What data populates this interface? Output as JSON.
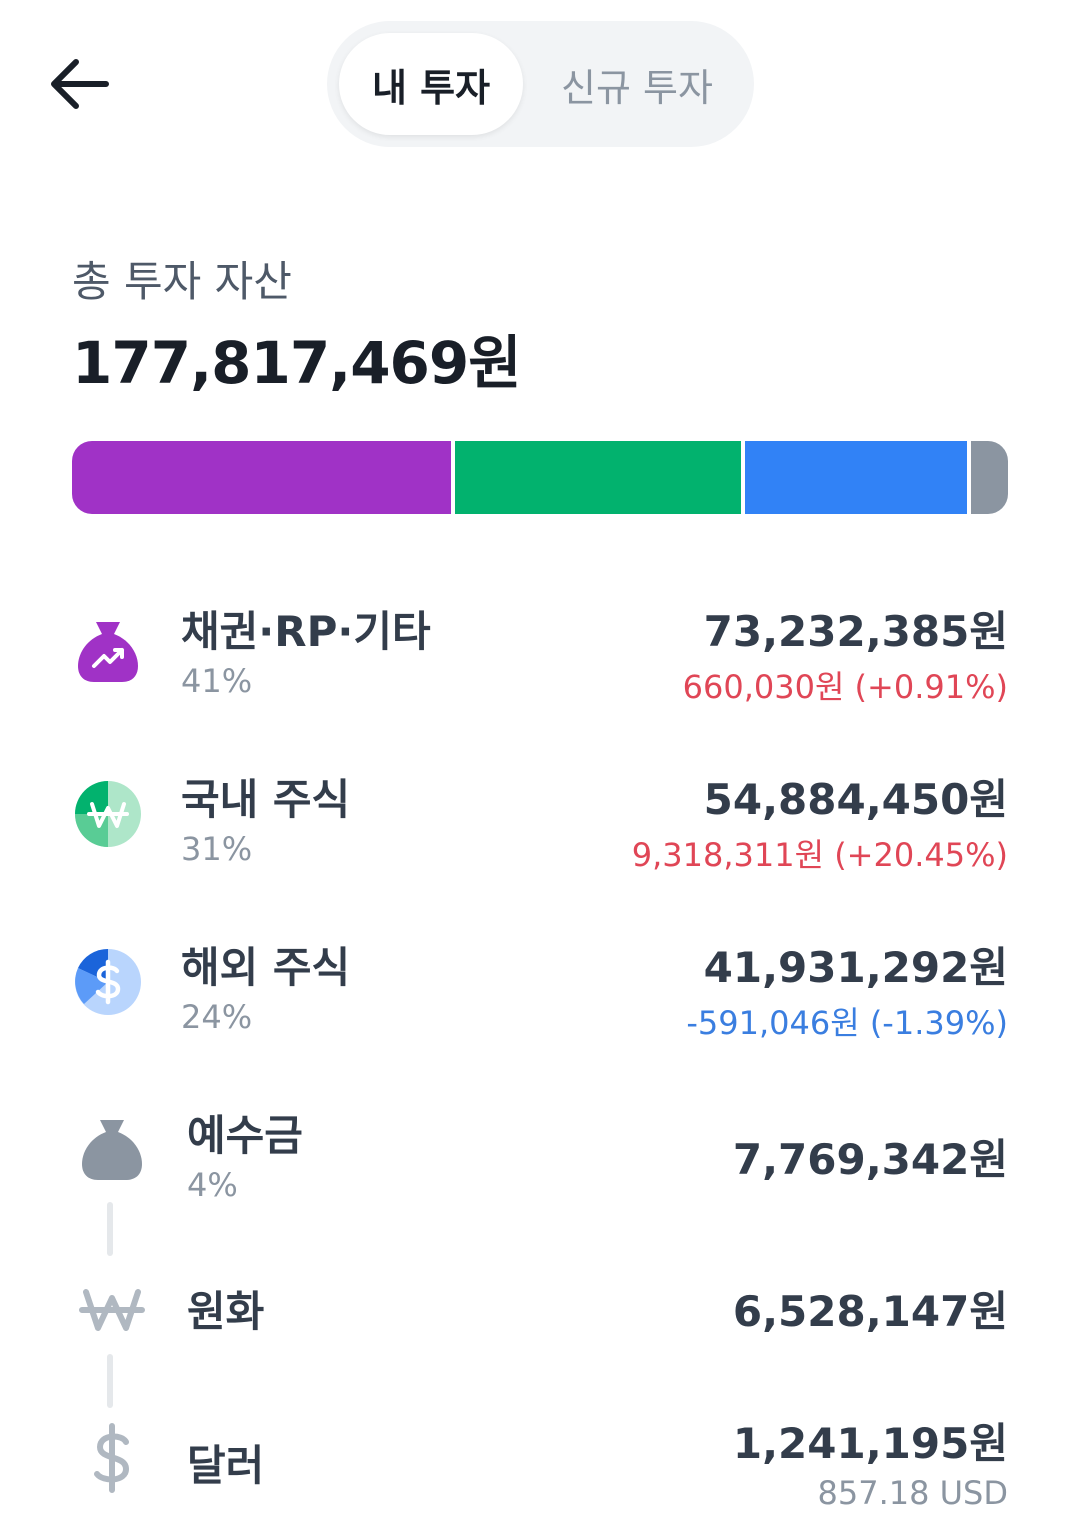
{
  "header": {
    "back_icon": "arrow-left-icon",
    "tabs": [
      {
        "label": "내 투자",
        "active": true
      },
      {
        "label": "신규 투자",
        "active": false
      }
    ]
  },
  "summary": {
    "label": "총 투자 자산",
    "total": "177,817,469원"
  },
  "allocation_bar": [
    {
      "name": "채권·RP·기타",
      "fraction": 0.41,
      "color": "#a032c6"
    },
    {
      "name": "국내 주식",
      "fraction": 0.31,
      "color": "#02b26e"
    },
    {
      "name": "해외 주식",
      "fraction": 0.24,
      "color": "#3182f6"
    },
    {
      "name": "예수금",
      "fraction": 0.04,
      "color": "#8b95a1"
    }
  ],
  "assets": [
    {
      "name": "채권·RP·기타",
      "percent": "41%",
      "amount": "73,232,385원",
      "change": "660,030원 (+0.91%)",
      "trend": "up",
      "icon": "money-bag-chart-icon"
    },
    {
      "name": "국내 주식",
      "percent": "31%",
      "amount": "54,884,450원",
      "change": "9,318,311원 (+20.45%)",
      "trend": "up",
      "icon": "won-pie-icon"
    },
    {
      "name": "해외 주식",
      "percent": "24%",
      "amount": "41,931,292원",
      "change": "-591,046원 (-1.39%)",
      "trend": "down",
      "icon": "dollar-pie-icon"
    }
  ],
  "deposit": {
    "name": "예수금",
    "percent": "4%",
    "amount": "7,769,342원",
    "icon": "money-bag-icon",
    "sub": [
      {
        "name": "원화",
        "amount": "6,528,147원",
        "icon": "won-icon"
      },
      {
        "name": "달러",
        "amount": "1,241,195원",
        "note": "857.18 USD",
        "icon": "dollar-icon"
      }
    ]
  }
}
